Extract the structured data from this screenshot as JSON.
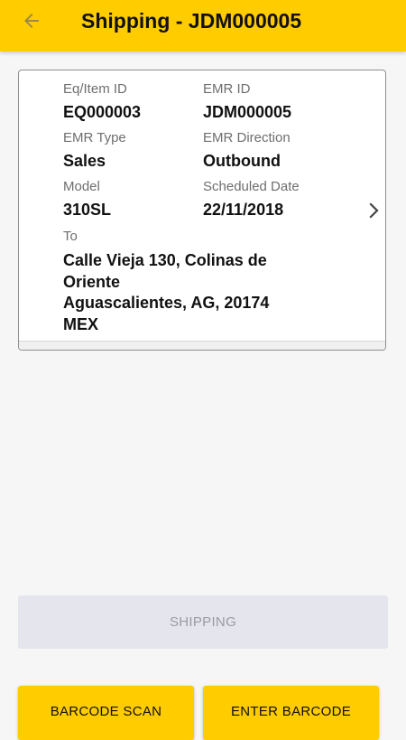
{
  "header": {
    "title": "Shipping - JDM000005",
    "back_icon": "arrow-left-icon",
    "background_color": "#ffcc00"
  },
  "card": {
    "eq_item_id": {
      "label": "Eq/Item ID",
      "value": "EQ000003"
    },
    "emr_id": {
      "label": "EMR ID",
      "value": "JDM000005"
    },
    "emr_type": {
      "label": "EMR Type",
      "value": "Sales"
    },
    "emr_direction": {
      "label": "EMR Direction",
      "value": "Outbound"
    },
    "model": {
      "label": "Model",
      "value": "310SL"
    },
    "scheduled_date": {
      "label": "Scheduled Date",
      "value": "22/11/2018"
    },
    "to": {
      "label": "To",
      "lines": [
        "Calle Vieja 130, Colinas de",
        "Oriente",
        "Aguascalientes, AG, 20174",
        "MEX"
      ]
    },
    "chevron_icon": "chevron-right-icon"
  },
  "actions": {
    "shipping_label": "SHIPPING",
    "shipping_enabled": false,
    "barcode_scan_label": "BARCODE SCAN",
    "enter_barcode_label": "ENTER BARCODE"
  }
}
